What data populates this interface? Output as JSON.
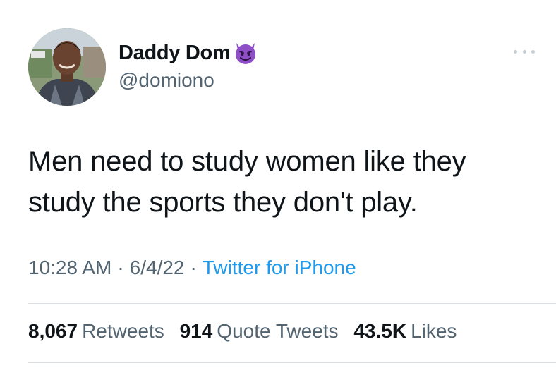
{
  "author": {
    "display_name": "Daddy Dom",
    "emoji_icon": "smiling-face-with-horns-icon",
    "handle": "@domiono"
  },
  "tweet": {
    "text_line_1": "Men need to study women like they",
    "text_line_2": "study the sports they don't play."
  },
  "meta": {
    "time": "10:28 AM",
    "separator": "·",
    "date": "6/4/22",
    "source": "Twitter for iPhone"
  },
  "stats": {
    "retweets_count": "8,067",
    "retweets_label": "Retweets",
    "quotes_count": "914",
    "quotes_label": "Quote Tweets",
    "likes_count": "43.5K",
    "likes_label": "Likes"
  },
  "colors": {
    "text_primary": "#0f1419",
    "text_secondary": "#536471",
    "link": "#1d9bf0",
    "divider": "#dbe0e4",
    "emoji_purple": "#8e4ec6"
  }
}
